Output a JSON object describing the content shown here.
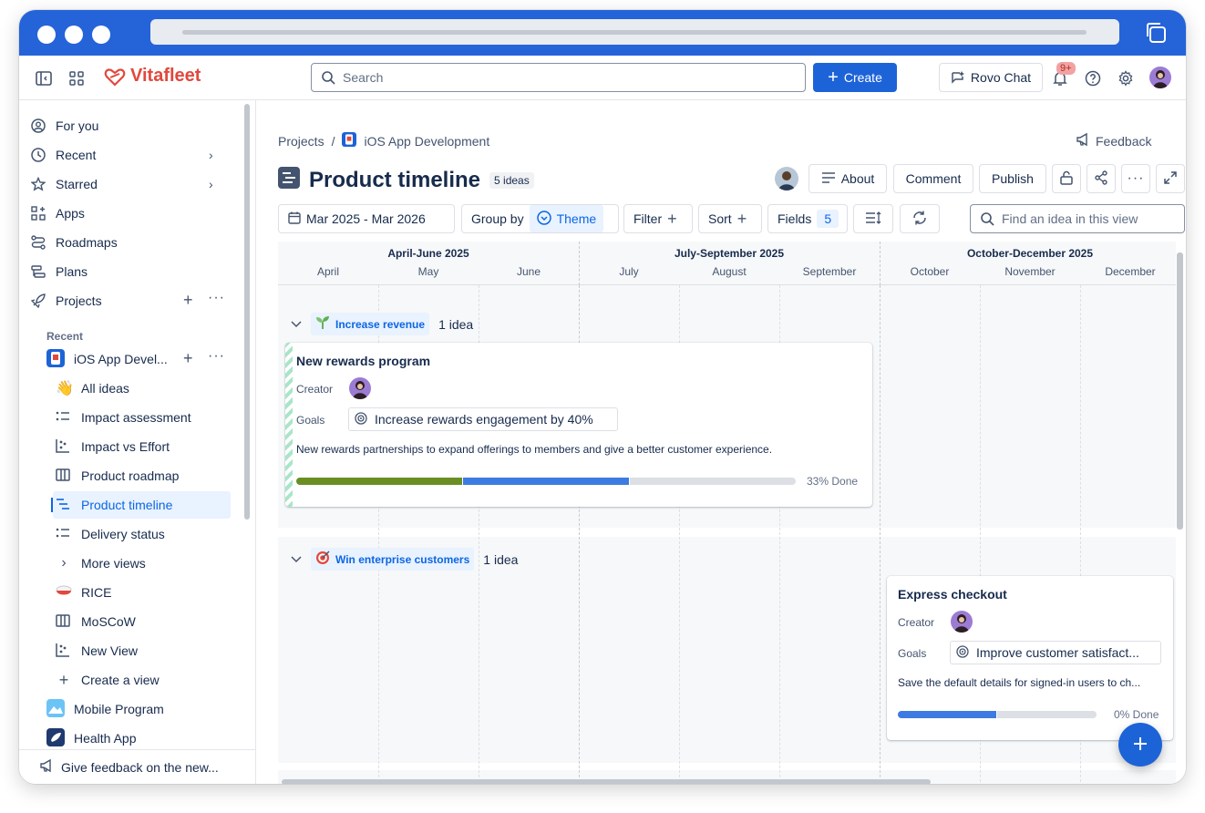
{
  "app": {
    "name": "Vitafleet"
  },
  "colors": {
    "titlebar": "#2563d9",
    "primary": "#1d63d8",
    "accent_text": "#0c66e4",
    "logo": "#e2483d",
    "progress_green": "#6a8e23",
    "progress_blue": "#3d7be0",
    "progress_gray": "#dcdfe4"
  },
  "topnav": {
    "search_placeholder": "Search",
    "create_label": "Create",
    "rovo_label": "Rovo Chat",
    "notifications_badge": "9+"
  },
  "sidebar": {
    "items": [
      {
        "label": "For you",
        "icon": "user-circle-icon"
      },
      {
        "label": "Recent",
        "icon": "clock-icon"
      },
      {
        "label": "Starred",
        "icon": "star-icon"
      },
      {
        "label": "Apps",
        "icon": "apps-icon"
      },
      {
        "label": "Roadmaps",
        "icon": "roadmap-icon"
      },
      {
        "label": "Plans",
        "icon": "plans-icon"
      },
      {
        "label": "Projects",
        "icon": "rocket-icon"
      }
    ],
    "recent_label": "Recent",
    "project": {
      "label": "iOS App Devel..."
    },
    "project_views": [
      {
        "label": "All ideas"
      },
      {
        "label": "Impact assessment"
      },
      {
        "label": "Impact vs Effort"
      },
      {
        "label": "Product roadmap"
      },
      {
        "label": "Product timeline"
      },
      {
        "label": "Delivery status"
      },
      {
        "label": "More views"
      },
      {
        "label": "RICE"
      },
      {
        "label": "MoSCoW"
      },
      {
        "label": "New View"
      },
      {
        "label": "Create a view"
      }
    ],
    "other_projects": [
      {
        "label": "Mobile Program"
      },
      {
        "label": "Health App"
      }
    ],
    "feedback_label": "Give feedback on the new..."
  },
  "main": {
    "breadcrumb": {
      "root": "Projects",
      "separator": "/",
      "project": "iOS App Development"
    },
    "feedback_label": "Feedback",
    "title": "Product timeline",
    "idea_count": "5 ideas",
    "header_buttons": {
      "about": "About",
      "comment": "Comment",
      "publish": "Publish"
    },
    "toolbar": {
      "date_range": "Mar 2025 - Mar 2026",
      "group_by_label": "Group by",
      "group_by_value": "Theme",
      "filter_label": "Filter",
      "sort_label": "Sort",
      "fields_label": "Fields",
      "fields_count": "5",
      "find_placeholder": "Find an idea in this view"
    }
  },
  "timeline": {
    "quarters": [
      "April-June 2025",
      "July-September 2025",
      "October-December 2025"
    ],
    "months": [
      "April",
      "May",
      "June",
      "July",
      "August",
      "September",
      "October",
      "November",
      "December"
    ],
    "groups": [
      {
        "theme": "Increase revenue",
        "count": "1 idea",
        "icon": "sprout-icon",
        "card": {
          "title": "New rewards program",
          "creator_label": "Creator",
          "goals_label": "Goals",
          "goal": "Increase rewards engagement by 40%",
          "description": "New rewards partnerships to expand offerings to members and give a better customer experience.",
          "progress_label": "33% Done",
          "progress": {
            "done": 0.33,
            "in_progress": 0.33
          }
        }
      },
      {
        "theme": "Win enterprise customers",
        "count": "1 idea",
        "icon": "target-icon",
        "card": {
          "title": "Express checkout",
          "creator_label": "Creator",
          "goals_label": "Goals",
          "goal": "Improve customer satisfact...",
          "description": "Save the default details for signed-in users to ch...",
          "progress_label": "0% Done",
          "progress": {
            "done": 0,
            "in_progress": 0.5
          }
        }
      },
      {
        "icon": "heart-icon"
      }
    ]
  }
}
